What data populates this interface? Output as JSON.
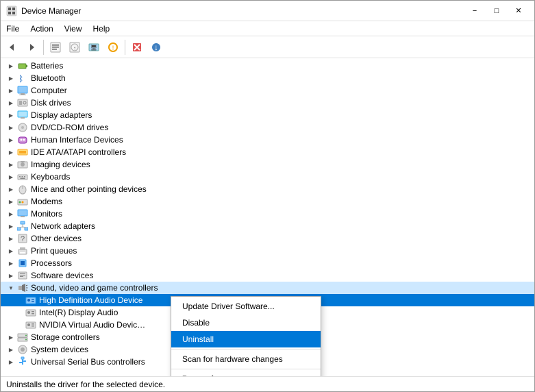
{
  "window": {
    "title": "Device Manager",
    "title_icon": "💻"
  },
  "menu": {
    "items": [
      "File",
      "Action",
      "View",
      "Help"
    ]
  },
  "toolbar": {
    "buttons": [
      "←",
      "→",
      "📋",
      "📄",
      "🖥",
      "⭐",
      "❌",
      "⬇"
    ]
  },
  "tree": {
    "items": [
      {
        "id": "batteries",
        "label": "Batteries",
        "icon": "🔋",
        "level": 1,
        "expanded": false
      },
      {
        "id": "bluetooth",
        "label": "Bluetooth",
        "icon": "📡",
        "level": 1,
        "expanded": false
      },
      {
        "id": "computer",
        "label": "Computer",
        "icon": "💻",
        "level": 1,
        "expanded": false
      },
      {
        "id": "disk-drives",
        "label": "Disk drives",
        "icon": "💽",
        "level": 1,
        "expanded": false
      },
      {
        "id": "display-adapters",
        "label": "Display adapters",
        "icon": "🖥",
        "level": 1,
        "expanded": false
      },
      {
        "id": "dvd-rom",
        "label": "DVD/CD-ROM drives",
        "icon": "💿",
        "level": 1,
        "expanded": false
      },
      {
        "id": "hid",
        "label": "Human Interface Devices",
        "icon": "🎮",
        "level": 1,
        "expanded": false
      },
      {
        "id": "ide",
        "label": "IDE ATA/ATAPI controllers",
        "icon": "🔌",
        "level": 1,
        "expanded": false
      },
      {
        "id": "imaging",
        "label": "Imaging devices",
        "icon": "📷",
        "level": 1,
        "expanded": false
      },
      {
        "id": "keyboards",
        "label": "Keyboards",
        "icon": "⌨",
        "level": 1,
        "expanded": false
      },
      {
        "id": "mice",
        "label": "Mice and other pointing devices",
        "icon": "🖱",
        "level": 1,
        "expanded": false
      },
      {
        "id": "modems",
        "label": "Modems",
        "icon": "📟",
        "level": 1,
        "expanded": false
      },
      {
        "id": "monitors",
        "label": "Monitors",
        "icon": "🖥",
        "level": 1,
        "expanded": false
      },
      {
        "id": "network",
        "label": "Network adapters",
        "icon": "🌐",
        "level": 1,
        "expanded": false
      },
      {
        "id": "other",
        "label": "Other devices",
        "icon": "❓",
        "level": 1,
        "expanded": false
      },
      {
        "id": "print",
        "label": "Print queues",
        "icon": "🖨",
        "level": 1,
        "expanded": false
      },
      {
        "id": "processors",
        "label": "Processors",
        "icon": "⚙",
        "level": 1,
        "expanded": false
      },
      {
        "id": "software",
        "label": "Software devices",
        "icon": "📦",
        "level": 1,
        "expanded": false
      },
      {
        "id": "sound",
        "label": "Sound, video and game controllers",
        "icon": "🔊",
        "level": 1,
        "expanded": true
      },
      {
        "id": "hda",
        "label": "High Definition Audio Device",
        "icon": "🔊",
        "level": 2,
        "selected": true
      },
      {
        "id": "intel-display",
        "label": "Intel(R) Display Audio",
        "icon": "🔊",
        "level": 2
      },
      {
        "id": "nvidia",
        "label": "NVIDIA Virtual Audio Devic…",
        "icon": "🔊",
        "level": 2
      },
      {
        "id": "storage",
        "label": "Storage controllers",
        "icon": "💾",
        "level": 1,
        "expanded": false
      },
      {
        "id": "system",
        "label": "System devices",
        "icon": "⚙",
        "level": 1,
        "expanded": false
      },
      {
        "id": "usb",
        "label": "Universal Serial Bus controllers",
        "icon": "🔌",
        "level": 1,
        "expanded": false
      }
    ]
  },
  "context_menu": {
    "items": [
      {
        "id": "update-driver",
        "label": "Update Driver Software...",
        "type": "normal"
      },
      {
        "id": "disable",
        "label": "Disable",
        "type": "normal"
      },
      {
        "id": "uninstall",
        "label": "Uninstall",
        "type": "highlighted"
      },
      {
        "id": "sep1",
        "type": "separator"
      },
      {
        "id": "scan",
        "label": "Scan for hardware changes",
        "type": "normal"
      },
      {
        "id": "sep2",
        "type": "separator"
      },
      {
        "id": "properties",
        "label": "Properties",
        "type": "bold"
      }
    ]
  },
  "status_bar": {
    "text": "Uninstalls the driver for the selected device."
  }
}
